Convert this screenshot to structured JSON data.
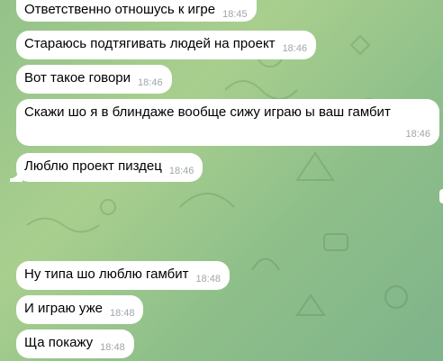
{
  "messages": [
    {
      "text": "Ответственно отношусь к игре",
      "time": "18:45"
    },
    {
      "text": "Стараюсь подтягивать людей на проект",
      "time": "18:46"
    },
    {
      "text": "Вот такое говори",
      "time": "18:46"
    },
    {
      "text": "Скажи шо я в блиндаже вообще сижу играю ы ваш гамбит",
      "time": "18:46"
    },
    {
      "text": "Люблю проект пиздец",
      "time": "18:46"
    },
    {
      "text": "Ну типа шо люблю гамбит",
      "time": "18:48"
    },
    {
      "text": "И играю уже",
      "time": "18:48"
    },
    {
      "text": "Ща покажу",
      "time": "18:48"
    }
  ],
  "colors": {
    "bubble": "#ffffff",
    "time": "#a0a6ab",
    "background": "#9cc78c"
  }
}
